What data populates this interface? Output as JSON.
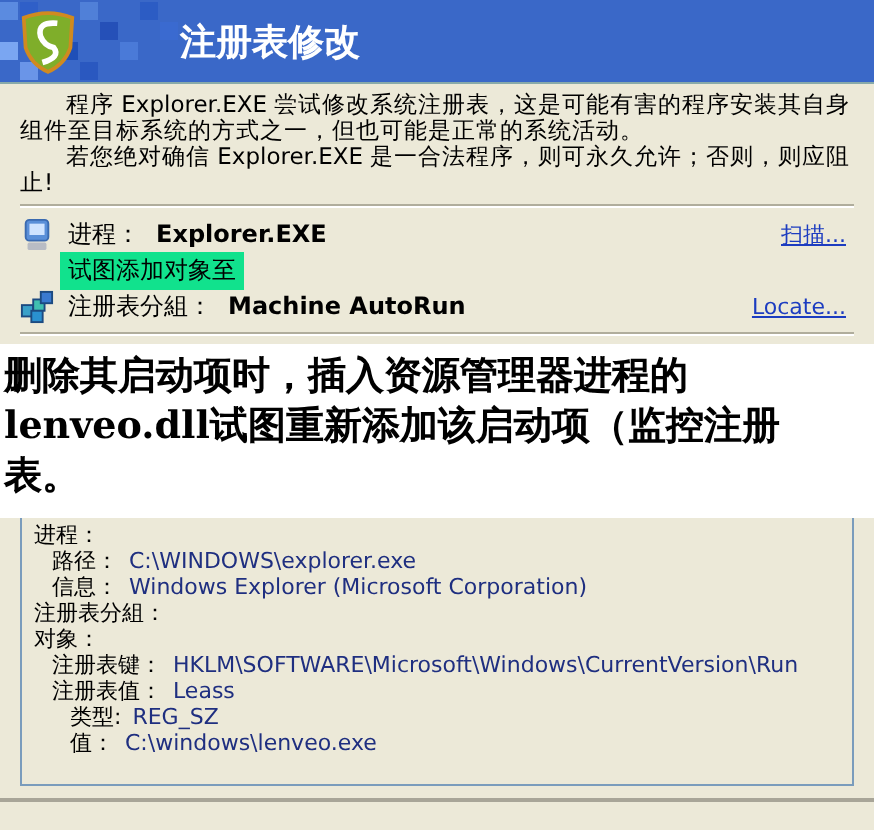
{
  "window": {
    "title": "注册表修改"
  },
  "description": [
    "程序 Explorer.EXE 尝试修改系统注册表，这是可能有害的程序安装其自身组件至目标系统的方式之一，但也可能是正常的系统活动。",
    "若您绝对确信 Explorer.EXE 是一合法程序，则可永久允许；否则，则应阻止!"
  ],
  "info_rows": [
    {
      "kind": "process",
      "label": "进程：",
      "value": "Explorer.EXE",
      "link": "扫描..."
    },
    {
      "kind": "note",
      "label": "试图添加对象至"
    },
    {
      "kind": "registry",
      "label": "注册表分組：",
      "value": "Machine AutoRun",
      "link": "Locate..."
    }
  ],
  "caption": [
    "删除其启动项时，插入资源管理器进程的",
    "lenveo.dll试图重新添加该启动项（监控注册",
    "表。"
  ],
  "details": [
    {
      "label": "进程：",
      "children": [
        {
          "label": "路径：",
          "value": "C:\\WINDOWS\\explorer.exe"
        },
        {
          "label": "信息：",
          "value": "Windows Explorer (Microsoft Corporation)"
        }
      ]
    },
    {
      "label": "注册表分組："
    },
    {
      "label": "对象：",
      "children": [
        {
          "label": "注册表键：",
          "value": "HKLM\\SOFTWARE\\Microsoft\\Windows\\CurrentVersion\\Run"
        },
        {
          "label": "注册表值：",
          "value": "Leass",
          "children": [
            {
              "label": "类型:",
              "value": "REG_SZ"
            },
            {
              "label": "值：",
              "value": "C:\\windows\\lenveo.exe"
            }
          ]
        }
      ]
    }
  ]
}
